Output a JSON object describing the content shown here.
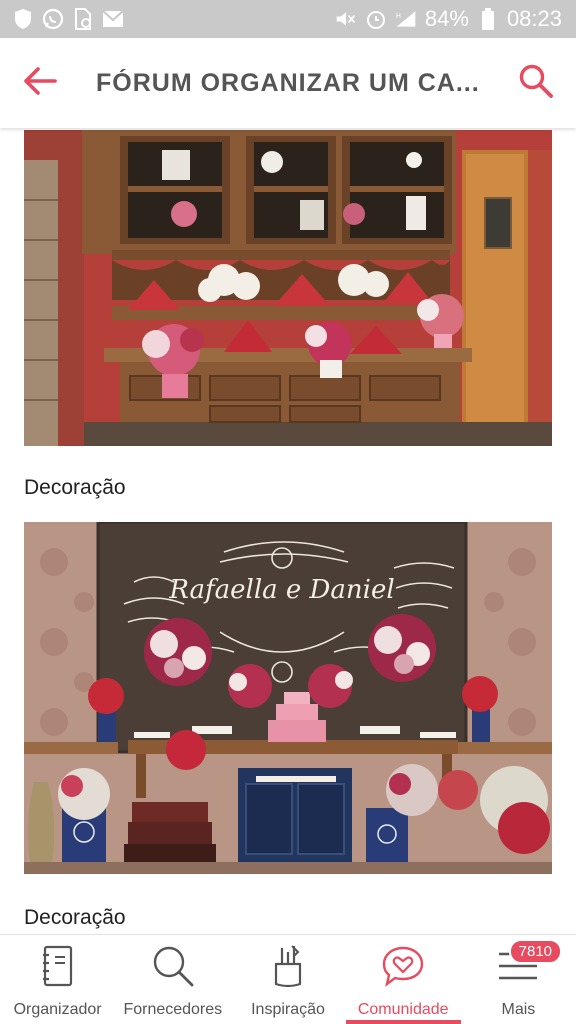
{
  "status_bar": {
    "battery": "84%",
    "time": "08:23",
    "left_icons": [
      "shield-icon",
      "whatsapp-icon",
      "file-icon",
      "mail-icon"
    ],
    "right_icons": [
      "mute-icon",
      "alarm-icon",
      "signal-icon",
      "battery-icon"
    ]
  },
  "header": {
    "title": "FÓRUM ORGANIZAR UM CA...",
    "back_icon": "arrow-left-icon",
    "search_icon": "search-icon",
    "accent": "#e84a5f"
  },
  "posts": [
    {
      "image": "decor-hutch-photo",
      "caption": ""
    },
    {
      "image": "decor-chalkboard-cake-table-photo",
      "caption": "Decoração",
      "chalkboard": {
        "names": "Rafaella e Daniel"
      }
    },
    {
      "image": "",
      "caption": "Decoração"
    }
  ],
  "bottom_nav": {
    "items": [
      {
        "label": "Organizador",
        "icon": "notebook-icon"
      },
      {
        "label": "Fornecedores",
        "icon": "search-icon"
      },
      {
        "label": "Inspiração",
        "icon": "brushes-icon"
      },
      {
        "label": "Comunidade",
        "icon": "heart-chat-icon",
        "active": true
      },
      {
        "label": "Mais",
        "icon": "menu-icon",
        "badge": "7810"
      }
    ]
  }
}
